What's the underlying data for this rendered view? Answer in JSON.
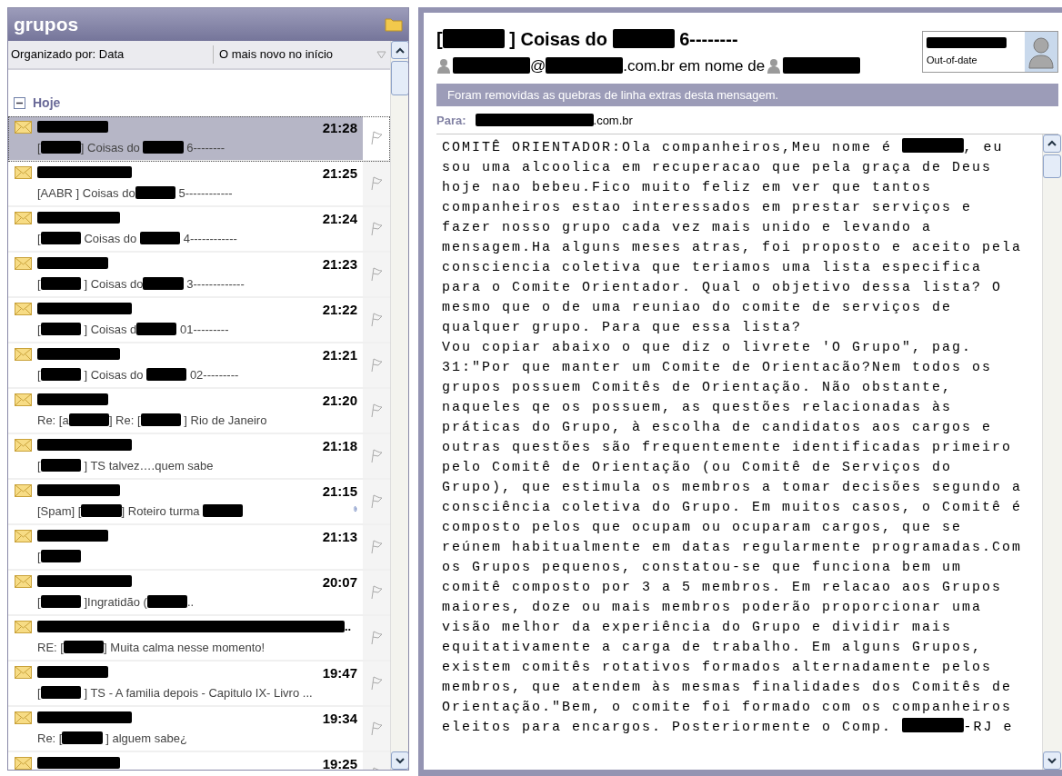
{
  "folder": {
    "title": "grupos"
  },
  "sort_bar": {
    "arranged_by": "Organizado por: Data",
    "order": "O mais novo no início"
  },
  "groups": [
    {
      "label": "Hoje",
      "expanded": true,
      "messages": [
        {
          "sender": [
            {
              "kind": "redaction"
            }
          ],
          "time": "21:28",
          "subject": [
            "[",
            {
              "kind": "redaction"
            },
            "] Coisas do ",
            {
              "kind": "redaction"
            },
            " 6--------"
          ],
          "selected": true,
          "attachment": false
        },
        {
          "sender": [
            {
              "kind": "redaction"
            }
          ],
          "time": "21:25",
          "subject": [
            "[AABR ] Coisas do",
            {
              "kind": "redaction"
            },
            " 5------------"
          ],
          "selected": false,
          "attachment": false
        },
        {
          "sender": [
            {
              "kind": "redaction"
            }
          ],
          "time": "21:24",
          "subject": [
            "[",
            {
              "kind": "redaction"
            },
            " Coisas do ",
            {
              "kind": "redaction"
            },
            " 4------------"
          ],
          "selected": false,
          "attachment": false
        },
        {
          "sender": [
            {
              "kind": "redaction"
            }
          ],
          "time": "21:23",
          "subject": [
            "[",
            {
              "kind": "redaction"
            },
            " ] Coisas do",
            {
              "kind": "redaction"
            },
            " 3-------------"
          ],
          "selected": false,
          "attachment": false
        },
        {
          "sender": [
            {
              "kind": "redaction"
            }
          ],
          "time": "21:22",
          "subject": [
            "[",
            {
              "kind": "redaction"
            },
            " ] Coisas d",
            {
              "kind": "redaction"
            },
            " 01---------"
          ],
          "selected": false,
          "attachment": false
        },
        {
          "sender": [
            {
              "kind": "redaction"
            }
          ],
          "time": "21:21",
          "subject": [
            "[",
            {
              "kind": "redaction"
            },
            " ] Coisas do ",
            {
              "kind": "redaction"
            },
            " 02---------"
          ],
          "selected": false,
          "attachment": false
        },
        {
          "sender": [
            {
              "kind": "redaction"
            }
          ],
          "time": "21:20",
          "subject": [
            "Re: [a",
            {
              "kind": "redaction"
            },
            "] Re: [",
            {
              "kind": "redaction"
            },
            " ] Rio de Janeiro"
          ],
          "selected": false,
          "attachment": false
        },
        {
          "sender": [
            {
              "kind": "redaction"
            }
          ],
          "time": "21:18",
          "subject": [
            "[",
            {
              "kind": "redaction"
            },
            " ] TS talvez….quem sabe"
          ],
          "selected": false,
          "attachment": false
        },
        {
          "sender": [
            {
              "kind": "redaction"
            }
          ],
          "time": "21:15",
          "subject": [
            "[Spam] [",
            {
              "kind": "redaction"
            },
            "] Roteiro turma ",
            {
              "kind": "redaction"
            }
          ],
          "selected": false,
          "attachment": true
        },
        {
          "sender": [
            {
              "kind": "redaction"
            }
          ],
          "time": "21:13",
          "subject": [
            "[",
            {
              "kind": "redaction"
            }
          ],
          "selected": false,
          "attachment": false
        },
        {
          "sender": [
            {
              "kind": "redaction"
            }
          ],
          "time": "20:07",
          "subject": [
            "[",
            {
              "kind": "redaction"
            },
            " ]Ingratidão (",
            {
              "kind": "redaction"
            },
            ".."
          ],
          "selected": false,
          "attachment": false
        },
        {
          "sender": [
            {
              "kind": "redaction"
            },
            ".."
          ],
          "subject": [
            "RE: [",
            {
              "kind": "redaction"
            },
            "] Muita calma nesse momento!"
          ],
          "selected": false,
          "attachment": false
        },
        {
          "sender": [
            {
              "kind": "redaction"
            }
          ],
          "time": "19:47",
          "subject": [
            "[",
            {
              "kind": "redaction"
            },
            " ] TS - A familia depois - Capitulo IX- Livro ..."
          ],
          "selected": false,
          "attachment": false
        },
        {
          "sender": [
            {
              "kind": "redaction"
            }
          ],
          "time": "19:34",
          "subject": [
            "Re: [",
            {
              "kind": "redaction"
            },
            " ] alguem sabe¿"
          ],
          "selected": false,
          "attachment": false
        },
        {
          "sender": [
            {
              "kind": "redaction"
            }
          ],
          "time": "19:25",
          "selected": false,
          "attachment": false
        }
      ]
    }
  ],
  "reading_pane": {
    "subject": [
      "[",
      {
        "kind": "redaction"
      },
      " ] Coisas do ",
      {
        "kind": "redaction"
      },
      " 6--------"
    ],
    "from": [
      {
        "kind": "person"
      },
      {
        "kind": "redaction"
      },
      "@",
      {
        "kind": "redaction"
      },
      ".com.br em nome de ",
      {
        "kind": "person"
      },
      {
        "kind": "redaction"
      }
    ],
    "contact_card": {
      "name": [
        {
          "kind": "redaction"
        }
      ],
      "status": "Out-of-date"
    },
    "infobar": "Foram removidas as quebras de linha extras desta mensagem.",
    "to_label": "Para:",
    "to": [
      {
        "kind": "redaction"
      },
      ".com.br"
    ],
    "body_lines": [
      [
        "COMITÊ ORIENTADOR:Ola companheiros,Meu nome é ",
        {
          "kind": "redaction"
        },
        ", eu"
      ],
      [
        "sou uma alcoolica em recuperacao que pela graça de Deus"
      ],
      [
        "hoje nao bebeu.Fico muito feliz em ver que tantos"
      ],
      [
        "companheiros estao interessados em prestar serviços e"
      ],
      [
        "fazer nosso grupo cada vez mais unido e levando a"
      ],
      [
        "mensagem.Ha alguns meses atras, foi proposto e aceito pela"
      ],
      [
        "consciencia coletiva que teriamos uma lista especifica"
      ],
      [
        "para o Comite Orientador. Qual o objetivo dessa lista? O"
      ],
      [
        "mesmo que o de uma reuniao do comite de serviços de"
      ],
      [
        "qualquer grupo. Para que essa lista?"
      ],
      [
        "Vou copiar abaixo o que diz o livrete 'O Grupo\", pag."
      ],
      [
        "31:\"Por que manter um Comite de Orientacão?Nem todos os"
      ],
      [
        "grupos possuem Comitês de Orientação. Não obstante,"
      ],
      [
        "naqueles qe os possuem, as questões relacionadas às"
      ],
      [
        "práticas do Grupo, à escolha de candidatos aos cargos e"
      ],
      [
        "outras questões são frequentemente identificadas primeiro"
      ],
      [
        "pelo Comitê de Orientação (ou Comitê de Serviços do"
      ],
      [
        "Grupo), que estimula os membros a tomar decisões segundo a"
      ],
      [
        "consciência coletiva do Grupo. Em muitos casos, o Comitê é"
      ],
      [
        "composto pelos que ocupam ou ocuparam cargos, que se"
      ],
      [
        "reúnem habitualmente em datas regularmente programadas.Com"
      ],
      [
        "os Grupos pequenos, constatou-se que funciona bem um"
      ],
      [
        "comitê composto por 3 a 5 membros. Em relacao aos Grupos"
      ],
      [
        "maiores, doze ou mais membros poderão proporcionar uma"
      ],
      [
        "visão melhor da experiência do Grupo e dividir mais"
      ],
      [
        "equitativamente a carga de trabalho. Em alguns Grupos,"
      ],
      [
        "existem comitês rotativos formados alternadamente pelos"
      ],
      [
        "membros, que atendem às mesmas finalidades dos Comitês de"
      ],
      [
        "Orientação.\"Bem, o comite foi formado com os companheiros"
      ],
      [
        "eleitos para encargos. Posteriormente o Comp. ",
        {
          "kind": "redaction"
        },
        "-RJ e"
      ]
    ]
  }
}
